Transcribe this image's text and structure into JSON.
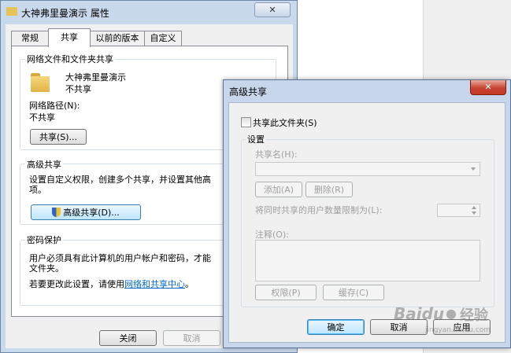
{
  "prop_window": {
    "title": "大神弗里曼演示 属性",
    "close_glyph": "✕",
    "tabs": [
      "常规",
      "共享",
      "以前的版本",
      "自定义"
    ],
    "active_tab": "共享",
    "net_share": {
      "group_title": "网络文件和文件夹共享",
      "folder_name": "大神弗里曼演示",
      "share_state": "不共享",
      "path_label": "网络路径(N):",
      "path_value": "不共享",
      "share_button": "共享(S)..."
    },
    "advanced": {
      "group_title": "高级共享",
      "description_line1": "设置自定义权限，创建多个共享，并设置其他高",
      "description_line2": "项。",
      "button": "高级共享(D)..."
    },
    "password": {
      "group_title": "密码保护",
      "line1": "用户必须具有此计算机的用户帐户和密码，才能",
      "line2": "文件夹。",
      "change_prefix": "若要更改此设置，请使用",
      "link": "网络和共享中心",
      "change_suffix": "。"
    },
    "footer": {
      "close": "关闭",
      "cancel": "取消"
    }
  },
  "adv_dialog": {
    "title": "高级共享",
    "close_glyph": "✕",
    "share_checkbox": "共享此文件夹(S)",
    "share_checked": false,
    "settings": {
      "group_title": "设置",
      "share_name_label": "共享名(H):",
      "share_name_value": "",
      "add_button": "添加(A)",
      "remove_button": "删除(R)",
      "limit_label": "将同时共享的用户数量限制为(L):",
      "limit_value": "",
      "comment_label": "注释(O):",
      "comment_value": "",
      "permissions_button": "权限(P)",
      "caching_button": "缓存(C)"
    },
    "footer": {
      "ok": "确定",
      "cancel": "取消",
      "apply": "应用"
    }
  },
  "watermark": {
    "brand": "Baidu",
    "cn": "经验",
    "url": "jingyan.baidu.com"
  }
}
